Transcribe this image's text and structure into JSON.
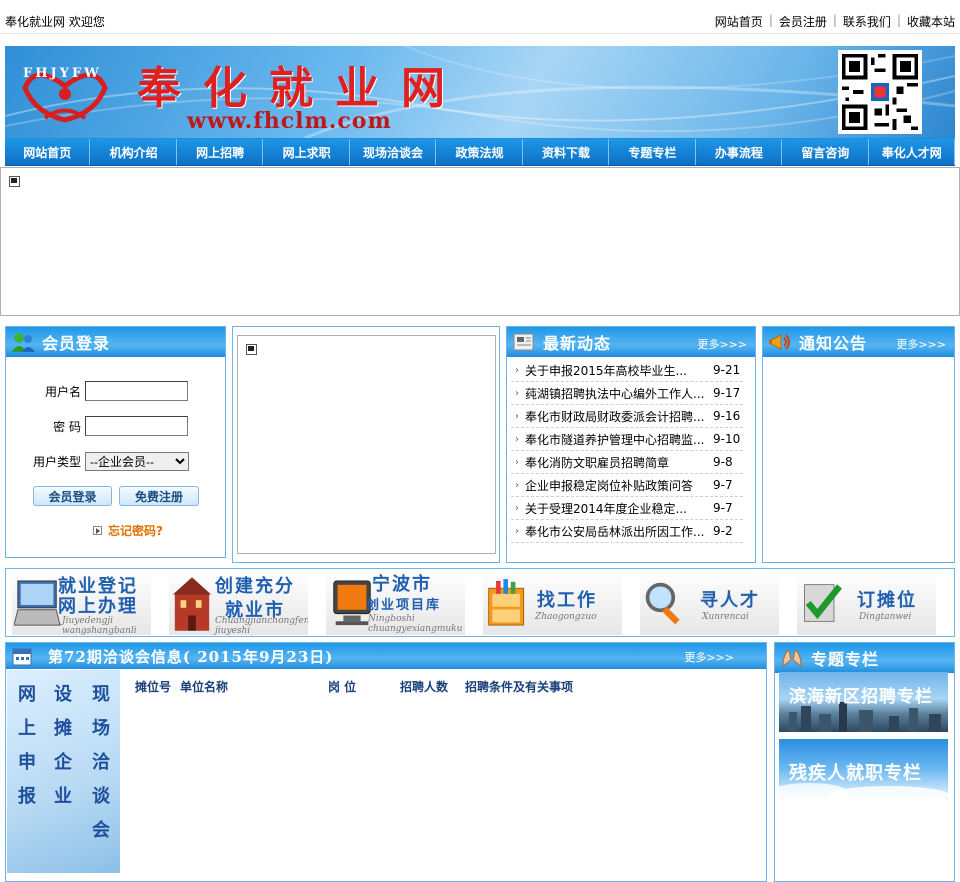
{
  "topbar": {
    "welcome": "奉化就业网  欢迎您",
    "links": [
      "网站首页",
      "会员注册",
      "联系我们",
      "收藏本站"
    ]
  },
  "banner": {
    "logo_text": "FHJYFW",
    "site_title": "奉化就业网",
    "site_url": "www.fhclm.com"
  },
  "nav": [
    "网站首页",
    "机构介绍",
    "网上招聘",
    "网上求职",
    "现场洽谈会",
    "政策法规",
    "资料下载",
    "专题专栏",
    "办事流程",
    "留言咨询",
    "奉化人才网"
  ],
  "login": {
    "title": "会员登录",
    "username_label": "用户名",
    "password_label": "密  码",
    "type_label": "用户类型",
    "type_selected": "--企业会员--",
    "login_button": "会员登录",
    "register_button": "免费注册",
    "forgot": "忘记密码?"
  },
  "news": {
    "title": "最新动态",
    "more": "更多>>>",
    "items": [
      {
        "title": "关于申报2015年高校毕业生...",
        "date": "9-21"
      },
      {
        "title": "莼湖镇招聘执法中心编外工作人...",
        "date": "9-17"
      },
      {
        "title": "奉化市财政局财政委派会计招聘...",
        "date": "9-16"
      },
      {
        "title": "奉化市隧道养护管理中心招聘监...",
        "date": "9-10"
      },
      {
        "title": "奉化消防文职雇员招聘简章",
        "date": "9-8"
      },
      {
        "title": "企业申报稳定岗位补贴政策问答",
        "date": "9-7"
      },
      {
        "title": "关于受理2014年度企业稳定...",
        "date": "9-7"
      },
      {
        "title": "奉化市公安局岳林派出所因工作...",
        "date": "9-2"
      }
    ]
  },
  "notice": {
    "title": "通知公告",
    "more": "更多>>>"
  },
  "tiles": [
    {
      "cn1": "就业登记",
      "cn2": "网上办理",
      "py": "Jiuyedengji wangshangbanli"
    },
    {
      "cn1": "创建充分",
      "cn2": "就业市",
      "py": "Chuangjianchongfen jiuyeshi"
    },
    {
      "cn1": "宁波市",
      "cn2": "创业项目库",
      "py": "Ningboshi chuangyexiangmuku"
    },
    {
      "cn1": "找工作",
      "cn2": "",
      "py": "Zhaogongzuo"
    },
    {
      "cn1": "寻人才",
      "cn2": "",
      "py": "Xunrencai"
    },
    {
      "cn1": "订摊位",
      "cn2": "",
      "py": "Dingtanwei"
    }
  ],
  "fair": {
    "title": "第72期洽谈会信息( 2015年9月23日)",
    "more": "更多>>>",
    "vertical_cols": [
      "网上申报",
      "设摊企业",
      "现场洽谈会"
    ],
    "columns": [
      "摊位号",
      "单位名称",
      "岗  位",
      "招聘人数",
      "招聘条件及有关事项"
    ]
  },
  "special": {
    "title": "专题专栏",
    "items": [
      "滨海新区招聘专栏",
      "残疾人就职专栏"
    ]
  }
}
